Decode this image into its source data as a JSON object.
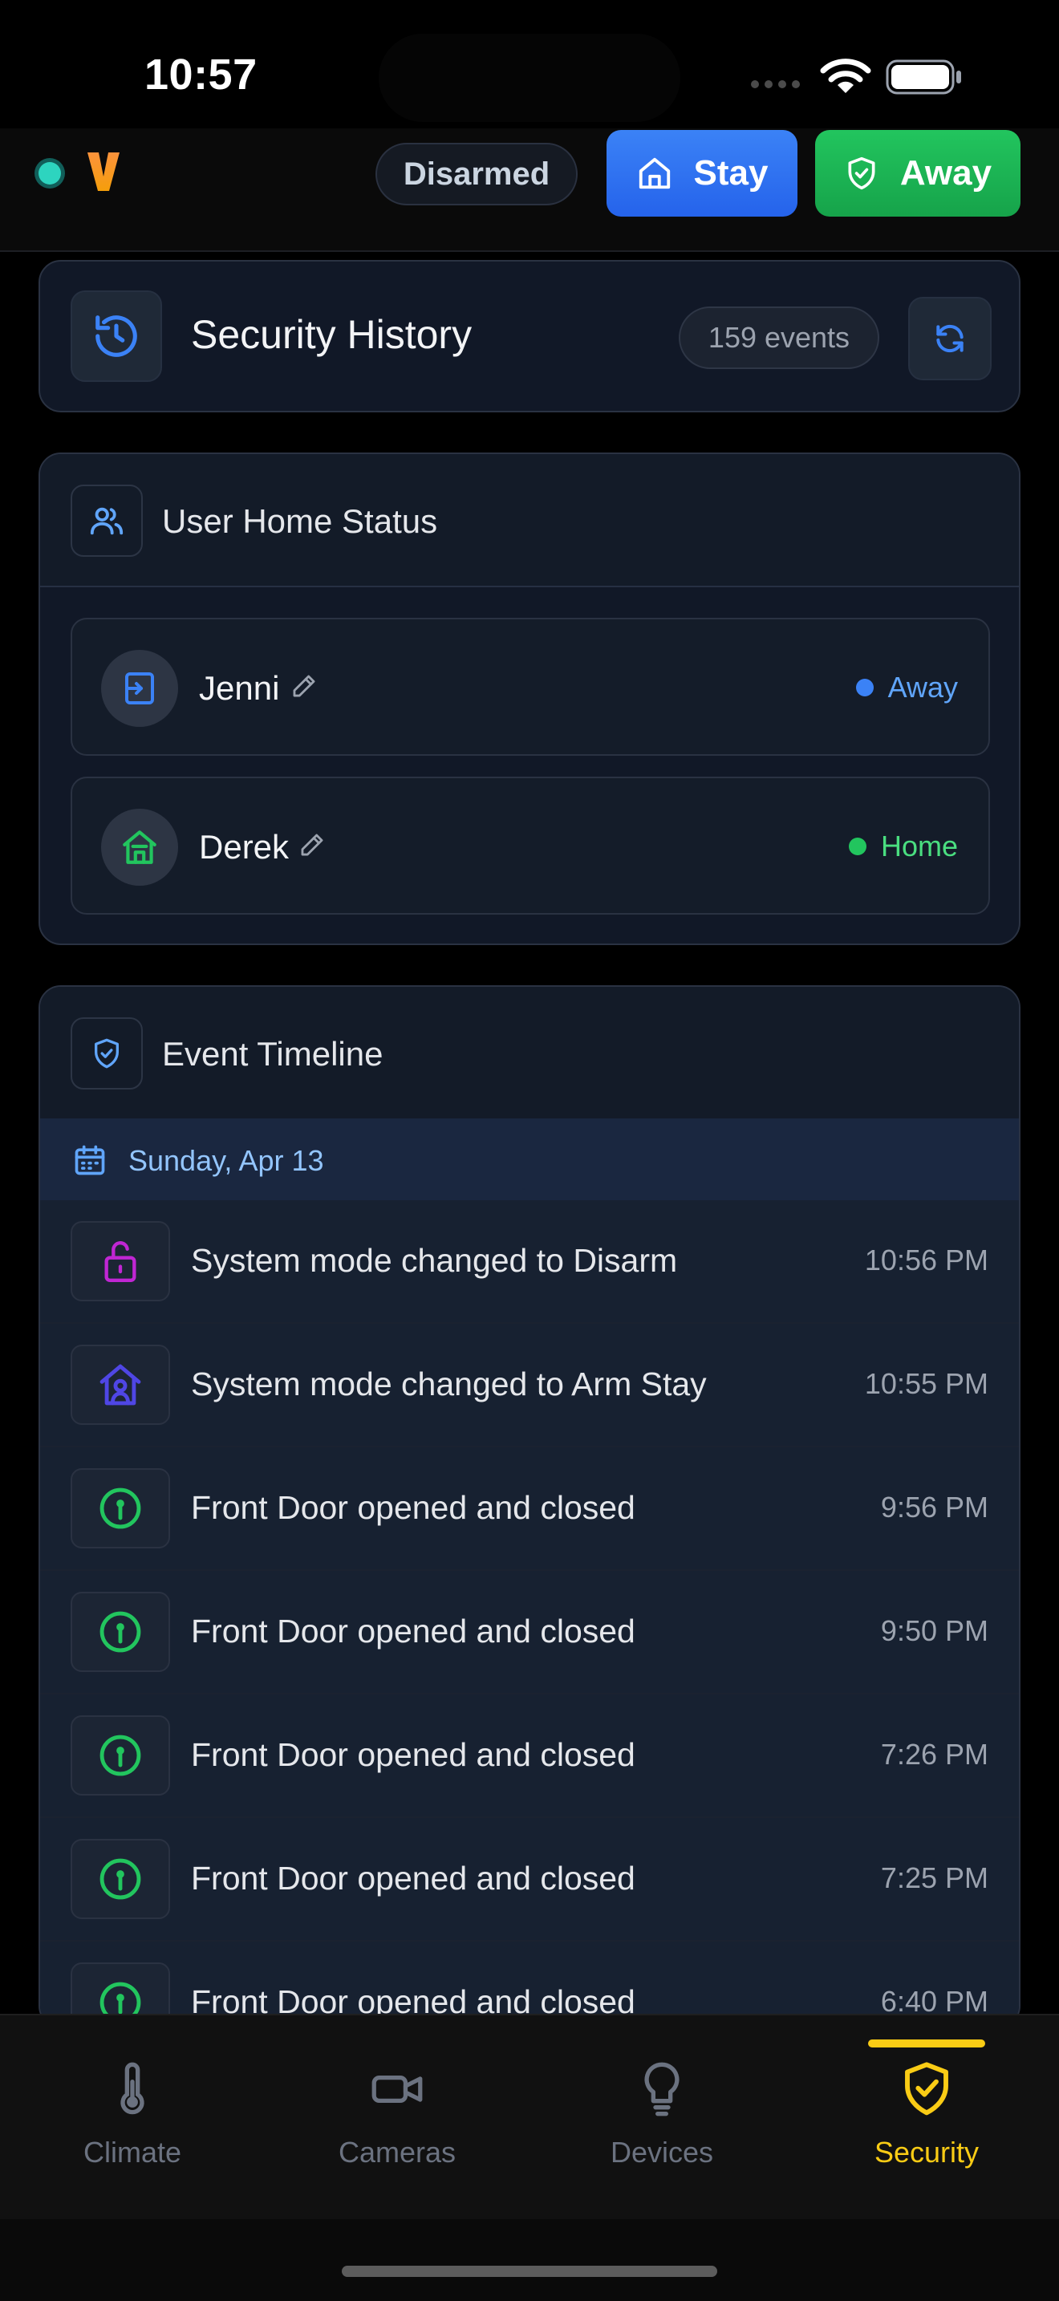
{
  "status_bar": {
    "time": "10:57"
  },
  "header": {
    "logo_letter": "V",
    "mode_pill": "Disarmed",
    "stay_label": "Stay",
    "away_label": "Away"
  },
  "history": {
    "title": "Security History",
    "event_count": "159 events"
  },
  "user_status": {
    "title": "User Home Status",
    "users": [
      {
        "name": "Jenni",
        "status": "Away",
        "status_color": "#3b82f6",
        "icon": "enter-icon"
      },
      {
        "name": "Derek",
        "status": "Home",
        "status_color": "#22c55e",
        "icon": "home-icon"
      }
    ]
  },
  "timeline": {
    "title": "Event Timeline",
    "date": "Sunday, Apr 13",
    "events": [
      {
        "text": "System mode changed to Disarm",
        "time": "10:56 PM",
        "icon": "unlock-icon",
        "color": "#c026d3"
      },
      {
        "text": "System mode changed to Arm Stay",
        "time": "10:55 PM",
        "icon": "home-person-icon",
        "color": "#4f46e5"
      },
      {
        "text": "Front Door opened and closed",
        "time": "9:56 PM",
        "icon": "door-sensor-icon",
        "color": "#22c55e"
      },
      {
        "text": "Front Door opened and closed",
        "time": "9:50 PM",
        "icon": "door-sensor-icon",
        "color": "#22c55e"
      },
      {
        "text": "Front Door opened and closed",
        "time": "7:26 PM",
        "icon": "door-sensor-icon",
        "color": "#22c55e"
      },
      {
        "text": "Front Door opened and closed",
        "time": "7:25 PM",
        "icon": "door-sensor-icon",
        "color": "#22c55e"
      },
      {
        "text": "Front Door opened and closed",
        "time": "6:40 PM",
        "icon": "door-sensor-icon",
        "color": "#22c55e"
      }
    ]
  },
  "nav": {
    "items": [
      {
        "label": "Climate",
        "icon": "thermometer-icon"
      },
      {
        "label": "Cameras",
        "icon": "video-camera-icon"
      },
      {
        "label": "Devices",
        "icon": "lightbulb-icon"
      },
      {
        "label": "Security",
        "icon": "shield-check-icon",
        "active": true
      }
    ]
  },
  "colors": {
    "accent_blue": "#3b82f6",
    "accent_green": "#22c55e",
    "active_nav": "#facc15"
  }
}
